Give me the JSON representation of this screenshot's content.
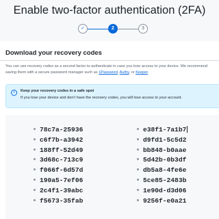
{
  "header": {
    "title": "Enable two-factor authentication (2FA)",
    "steps": [
      {
        "label": "✓",
        "state": "done"
      },
      {
        "label": "2",
        "state": "active"
      },
      {
        "label": "3",
        "state": "pending"
      }
    ]
  },
  "section": {
    "heading": "Download your recovery codes",
    "description_part1": "You can use recovery codes as a second factor to authenticate in case you lose access to your device. We recommend saving them with a secure password manager such as ",
    "link_1password": "1Password",
    "sep1": ", ",
    "link_authy": "Authy",
    "sep2": ", or ",
    "link_keeper": "Keeper",
    "description_end": "."
  },
  "flash": {
    "icon": "info-icon",
    "title": "Keep your recovery codes in a safe spot",
    "body": "If you lose your device and don't have the recovery codes, you will lose access to your account."
  },
  "recovery_codes": {
    "left": [
      {
        "code": "78c7a-25936"
      },
      {
        "code": "c6f7b-a3942"
      },
      {
        "code": "188ff-52d49"
      },
      {
        "code": "3d68c-713c9"
      },
      {
        "code": "f066f-6d57d"
      },
      {
        "code": "190a5-7ef06"
      },
      {
        "code": "2c4f1-39abc"
      },
      {
        "code": "f5673-35fab"
      }
    ],
    "right": [
      {
        "code": "e38f1-7a1b7"
      },
      {
        "code": "d9fd1-5c5d2"
      },
      {
        "code": "bb848-b0aae"
      },
      {
        "code": "5d42b-0b3df"
      },
      {
        "code": "db5a8-4fe6e"
      },
      {
        "code": "5ce85-2483b"
      },
      {
        "code": "1e90d-d3d06"
      },
      {
        "code": "9256f-e0a21"
      }
    ]
  },
  "colors": {
    "accent": "#0969da",
    "flash_bg": "#ddf4ff",
    "codes_bg": "#f6f8fa"
  }
}
